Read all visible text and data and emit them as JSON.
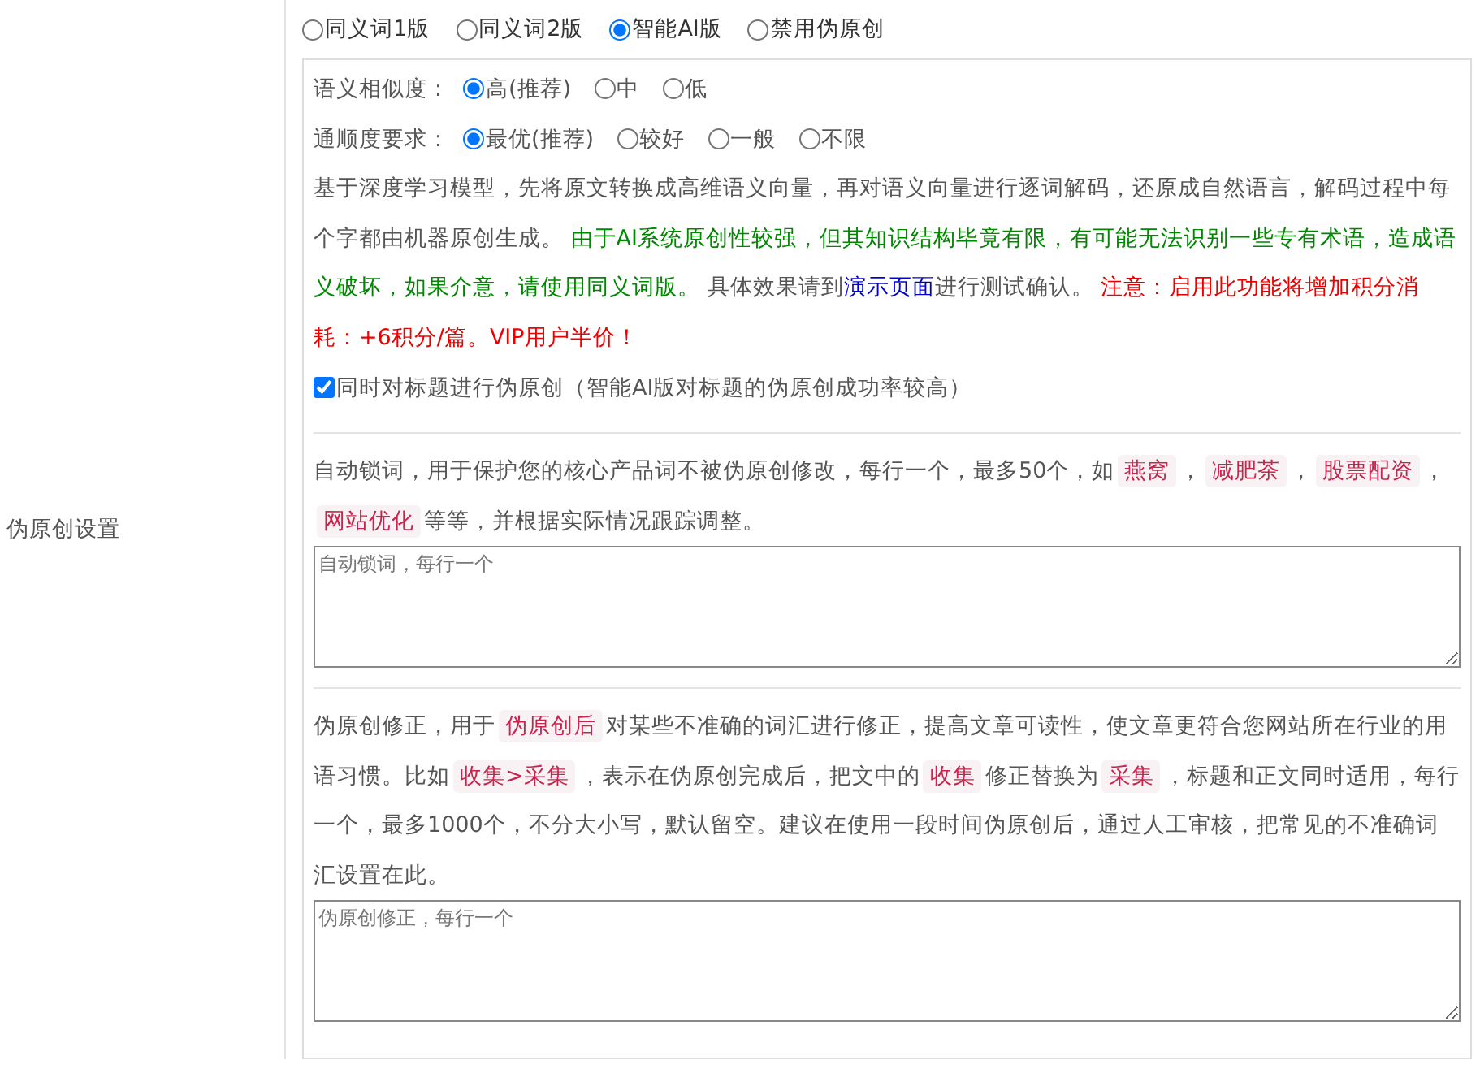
{
  "form_label": "伪原创设置",
  "modes": [
    {
      "label": "同义词1版",
      "selected": false
    },
    {
      "label": "同义词2版",
      "selected": false
    },
    {
      "label": "智能AI版",
      "selected": true
    },
    {
      "label": "禁用伪原创",
      "selected": false
    }
  ],
  "similarity": {
    "label": "语义相似度：",
    "options": [
      {
        "label": "高(推荐)",
        "selected": true
      },
      {
        "label": "中",
        "selected": false
      },
      {
        "label": "低",
        "selected": false
      }
    ]
  },
  "fluency": {
    "label": "通顺度要求：",
    "options": [
      {
        "label": "最优(推荐)",
        "selected": true
      },
      {
        "label": "较好",
        "selected": false
      },
      {
        "label": "一般",
        "selected": false
      },
      {
        "label": "不限",
        "selected": false
      }
    ]
  },
  "description": [
    {
      "kind": "plain",
      "text": "基于深度学习模型，先将原文转换成高维语义向量，再对语义向量进行逐词解码，还原成自然语言，解码过程中每个字都由机器原创生成。 "
    },
    {
      "kind": "success",
      "text": "由于AI系统原创性较强，但其知识结构毕竟有限，有可能无法识别一些专有术语，造成语义破坏，如果介意，请使用同义词版。"
    },
    {
      "kind": "plain",
      "text": " 具体效果请到"
    },
    {
      "kind": "link",
      "text": "演示页面"
    },
    {
      "kind": "plain",
      "text": "进行测试确认。 "
    },
    {
      "kind": "warning",
      "text": "注意：启用此功能将增加积分消耗：+6积分/篇。VIP用户半价！"
    }
  ],
  "title_option": {
    "label": "同时对标题进行伪原创（智能AI版对标题的伪原创成功率较高）",
    "checked": true
  },
  "lock_words": {
    "description": [
      {
        "kind": "plain",
        "text": "自动锁词，用于保护您的核心产品词不被伪原创修改，每行一个，最多50个，如"
      },
      {
        "kind": "code",
        "text": "燕窝"
      },
      {
        "kind": "plain",
        "text": "，"
      },
      {
        "kind": "code",
        "text": "减肥茶"
      },
      {
        "kind": "plain",
        "text": "，"
      },
      {
        "kind": "code",
        "text": "股票配资"
      },
      {
        "kind": "plain",
        "text": "，"
      },
      {
        "kind": "code",
        "text": "网站优化"
      },
      {
        "kind": "plain",
        "text": "等等，并根据实际情况跟踪调整。"
      }
    ],
    "placeholder": "自动锁词，每行一个"
  },
  "correction": {
    "description": [
      {
        "kind": "plain",
        "text": "伪原创修正，用于"
      },
      {
        "kind": "code",
        "text": "伪原创后"
      },
      {
        "kind": "plain",
        "text": "对某些不准确的词汇进行修正，提高文章可读性，使文章更符合您网站所在行业的用语习惯。比如"
      },
      {
        "kind": "code",
        "text": "收集>采集"
      },
      {
        "kind": "plain",
        "text": "，表示在伪原创完成后，把文中的"
      },
      {
        "kind": "code",
        "text": "收集"
      },
      {
        "kind": "plain",
        "text": "修正替换为"
      },
      {
        "kind": "code",
        "text": "采集"
      },
      {
        "kind": "plain",
        "text": "，标题和正文同时适用，每行一个，最多1000个，不分大小写，默认留空。建议在使用一段时间伪原创后，通过人工审核，把常见的不准确词汇设置在此。"
      }
    ],
    "placeholder": "伪原创修正，每行一个"
  }
}
